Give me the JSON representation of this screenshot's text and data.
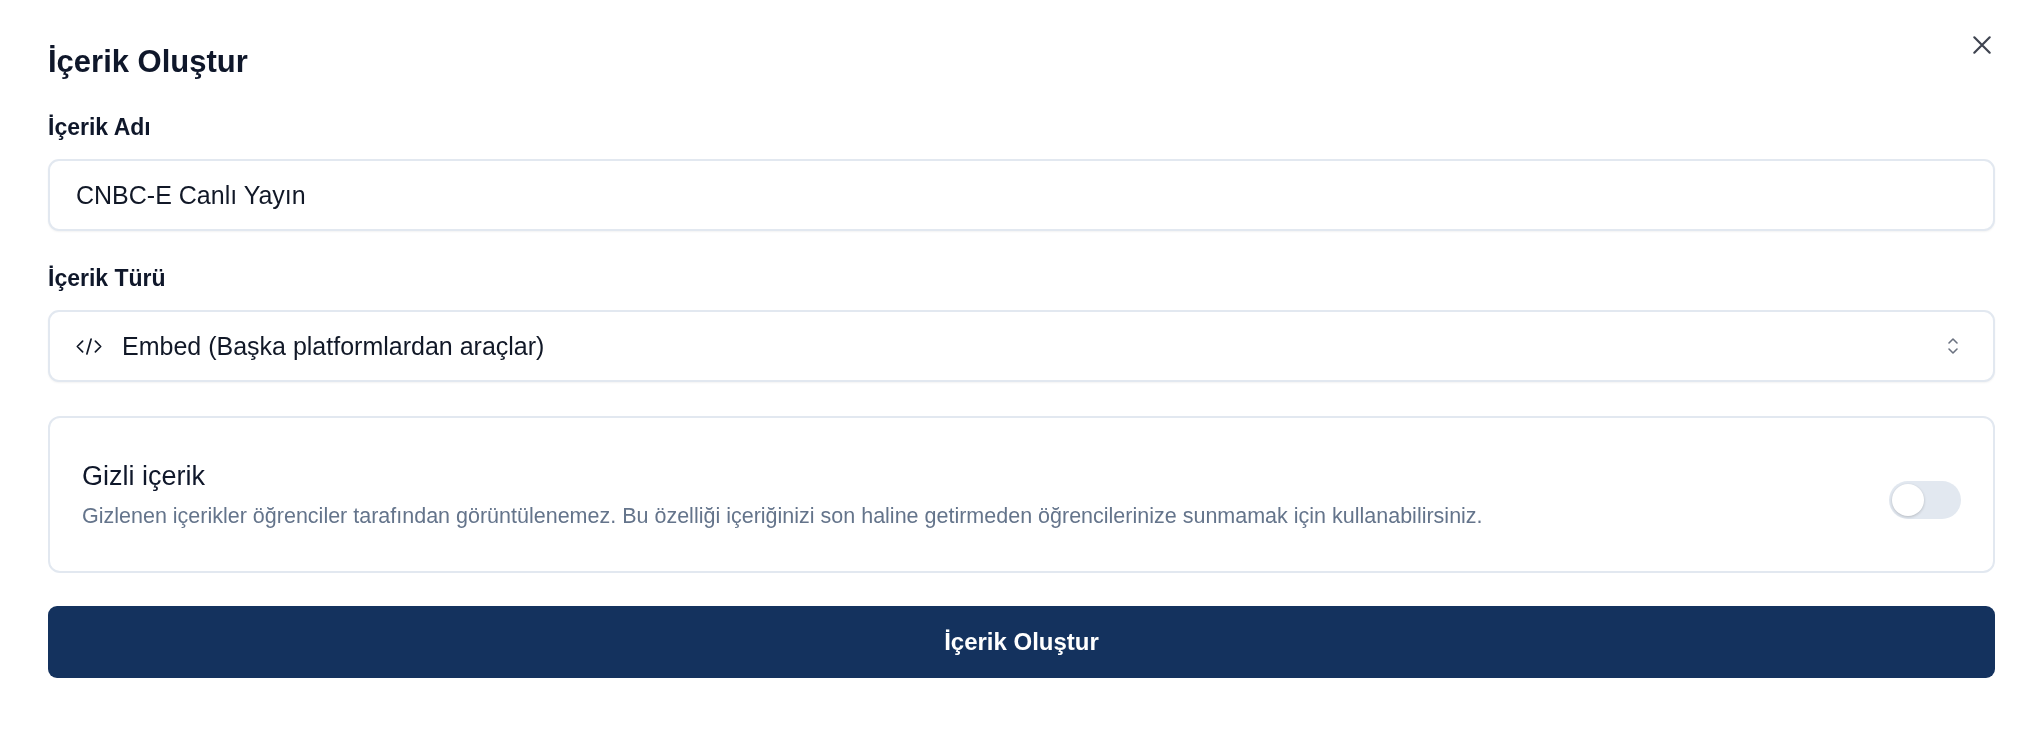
{
  "dialog": {
    "title": "İçerik Oluştur"
  },
  "fields": [
    {
      "kind": "text",
      "label": "İçerik Adı",
      "value": "CNBC-E Canlı Yayın"
    },
    {
      "kind": "select",
      "label": "İçerik Türü",
      "value": "Embed (Başka platformlardan araçlar)"
    }
  ],
  "hidden_option": {
    "title": "Gizli içerik",
    "description": "Gizlenen içerikler öğrenciler tarafından görüntülenemez. Bu özelliği içeriğinizi son haline getirmeden öğrencilerinize sunmamak için kullanabilirsiniz.",
    "on": false
  },
  "submit_button": "İçerik Oluştur"
}
